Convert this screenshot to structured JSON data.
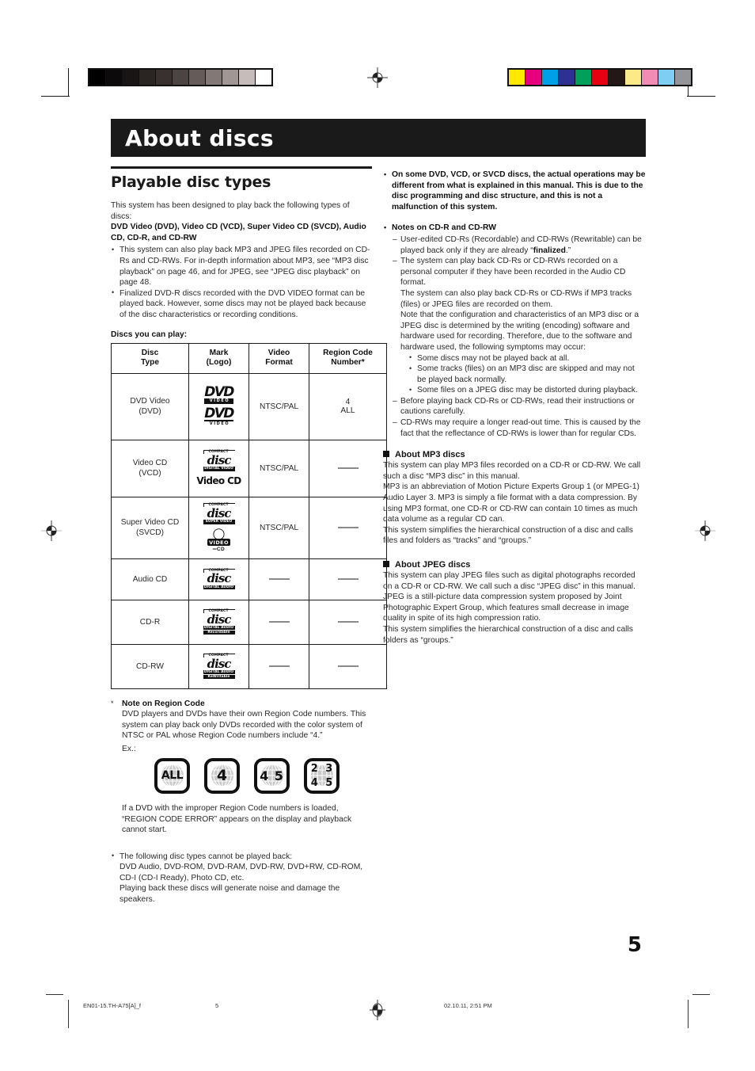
{
  "print_marks": {
    "gray_wedge": [
      "#000000",
      "#0c0a0a",
      "#191514",
      "#2a2422",
      "#383130",
      "#4c4442",
      "#655c59",
      "#827876",
      "#a09794",
      "#c6bdba",
      "#ffffff"
    ],
    "color_bars": [
      "#ffe800",
      "#e6007e",
      "#00a0e9",
      "#2e3192",
      "#00a05a",
      "#e60012",
      "#231815",
      "#fbe98a",
      "#f28cb4",
      "#7ecef4",
      "#939598"
    ],
    "registration_icon": "registration-crosshair-icon"
  },
  "banner": {
    "title": "About discs"
  },
  "left": {
    "section_title": "Playable disc types",
    "intro": "This system has been designed to play back the following types of discs:",
    "intro_bold": "DVD Video (DVD), Video CD (VCD), Super Video CD (SVCD), Audio CD, CD-R, and CD-RW",
    "bullets": [
      "This system can also play back MP3 and JPEG files recorded on CD-Rs and CD-RWs. For in-depth information about MP3, see “MP3 disc playback” on page 46, and for JPEG, see “JPEG disc playback” on page 48.",
      "Finalized DVD-R discs recorded with the DVD VIDEO format can be played back. However, some discs may not be played back because of the disc characteristics or recording conditions."
    ],
    "table_label": "Discs you can play:",
    "table": {
      "headers": [
        "Disc\nType",
        "Mark\n(Logo)",
        "Video\nFormat",
        "Region Code\nNumber*"
      ],
      "header_lines": [
        [
          "Disc",
          "Type"
        ],
        [
          "Mark",
          "(Logo)"
        ],
        [
          "Video",
          "Format"
        ],
        [
          "Region Code",
          "Number*"
        ]
      ],
      "rows": [
        {
          "type_lines": [
            "DVD Video",
            "(DVD)"
          ],
          "logos": [
            "dvd-video-logo",
            "dvd-video-logo-alt"
          ],
          "video_format": "NTSC/PAL",
          "region_lines": [
            "4",
            "ALL"
          ]
        },
        {
          "type_lines": [
            "Video CD",
            "(VCD)"
          ],
          "logos": [
            "compact-disc-digital-video-logo",
            "video-cd-wordmark-logo"
          ],
          "video_format": "NTSC/PAL",
          "region_lines": [
            "—"
          ]
        },
        {
          "type_lines": [
            "Super Video CD",
            "(SVCD)"
          ],
          "logos": [
            "compact-disc-super-video-logo",
            "svcd-video-cd-logo"
          ],
          "video_format": "NTSC/PAL",
          "region_lines": [
            "—"
          ]
        },
        {
          "type_lines": [
            "Audio CD"
          ],
          "logos": [
            "compact-disc-digital-audio-logo"
          ],
          "video_format": "—",
          "region_lines": [
            "—"
          ]
        },
        {
          "type_lines": [
            "CD-R"
          ],
          "logos": [
            "compact-disc-recordable-logo"
          ],
          "video_format": "—",
          "region_lines": [
            "—"
          ]
        },
        {
          "type_lines": [
            "CD-RW"
          ],
          "logos": [
            "compact-disc-rewritable-logo"
          ],
          "video_format": "—",
          "region_lines": [
            "—"
          ]
        }
      ]
    },
    "note_marker": "*",
    "note_title": "Note on Region Code",
    "note_body": "DVD players and DVDs have their own Region Code numbers. This system can play back only DVDs recorded with the color system of NTSC or PAL whose Region Code numbers include “4.”",
    "ex_label": "Ex.:",
    "region_badges": [
      {
        "name": "region-code-all-badge",
        "kind": "text",
        "value": "ALL"
      },
      {
        "name": "region-code-4-badge",
        "kind": "text",
        "value": "4"
      },
      {
        "name": "region-code-45-badge",
        "kind": "text",
        "value": "4 5"
      },
      {
        "name": "region-code-2345-badge",
        "kind": "quad",
        "values": [
          "2",
          "3",
          "4",
          "5"
        ]
      }
    ],
    "note_after": "If a DVD with the improper Region Code numbers is loaded, “REGION CODE ERROR” appears on the display and playback cannot start.",
    "cannot_play": [
      "The following disc types cannot be played back:",
      "DVD Audio, DVD-ROM, DVD-RAM, DVD-RW, DVD+RW, CD-ROM, CD-I (CD-I Ready), Photo CD, etc.",
      "Playing back these discs will generate noise and damage the speakers."
    ]
  },
  "right": {
    "bullet_bold": "On some DVD, VCD, or SVCD discs, the actual operations may be different from what is explained in this manual. This is due to the disc programming and disc structure, and this is not a malfunction of this system.",
    "notes_heading": "Notes on CD-R and CD-RW",
    "note1_pre": "User-edited CD-Rs (Recordable) and CD-RWs (Rewritable) can be played back only if they are already “",
    "note1_bold": "finalized",
    "note1_post": ".”",
    "note2": "The system can play back CD-Rs or CD-RWs recorded on a personal computer if they have been recorded in the Audio CD format.",
    "note2_cont1": "The system can also play back CD-Rs or CD-RWs if MP3 tracks (files) or JPEG files are recorded on them.",
    "note2_cont2": "Note that the configuration and characteristics of an MP3 disc or a JPEG disc is determined by the writing (encoding) software and hardware used for recording. Therefore, due to the software and hardware used, the following symptoms may occur:",
    "symptoms": [
      "Some discs may not be played back at all.",
      "Some tracks (files) on an MP3 disc are skipped and may not be played back normally.",
      "Some files on a JPEG disc may be distorted during playback."
    ],
    "note3": "Before playing back CD-Rs or CD-RWs, read their instructions or cautions carefully.",
    "note4": "CD-RWs may require a longer read-out time. This is caused by the fact that the reflectance of CD-RWs is lower than for regular CDs.",
    "mp3_heading": "About MP3 discs",
    "mp3_para1": "This system can play MP3 files recorded on a CD-R or CD-RW. We call such a disc “MP3 disc” in this manual.",
    "mp3_para2": "MP3 is an abbreviation of Motion Picture Experts Group 1 (or MPEG-1) Audio Layer 3. MP3 is simply a file format with a data compression. By using MP3 format, one CD-R or CD-RW can contain 10 times as much data volume as a regular CD can.",
    "mp3_para3": "This system simplifies the hierarchical construction of a disc and calls files and folders as “tracks” and “groups.”",
    "jpeg_heading": "About JPEG discs",
    "jpeg_para1": "This system can play JPEG files such as digital photographs recorded on a CD-R or CD-RW. We call such a disc “JPEG disc” in this manual.",
    "jpeg_para2": "JPEG is a still-picture data compression system proposed by Joint Photographic Expert Group, which features small decrease in image quality in spite of its high compression ratio.",
    "jpeg_para3": "This system simplifies the hierarchical construction of a disc and calls folders as “groups.”"
  },
  "page_number": "5",
  "footer": {
    "file_name": "EN01-15.TH-A75[A]_f",
    "page": "5",
    "timestamp": "02.10.11, 2:51 PM"
  }
}
